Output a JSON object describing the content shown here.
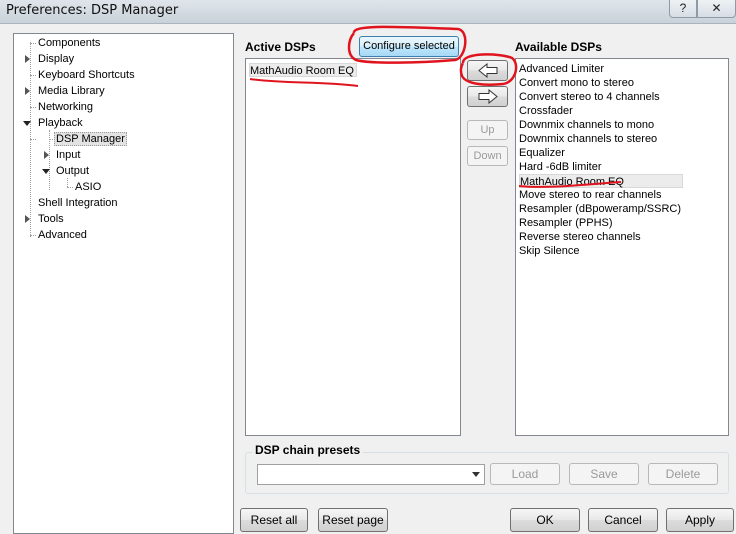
{
  "window": {
    "title": "Preferences: DSP Manager",
    "help_label": "?",
    "close_label": "✕"
  },
  "tree": {
    "items": [
      {
        "label": "Components"
      },
      {
        "label": "Display"
      },
      {
        "label": "Keyboard Shortcuts"
      },
      {
        "label": "Media Library"
      },
      {
        "label": "Networking"
      },
      {
        "label": "Playback"
      },
      {
        "label": "DSP Manager"
      },
      {
        "label": "Input"
      },
      {
        "label": "Output"
      },
      {
        "label": "ASIO"
      },
      {
        "label": "Shell Integration"
      },
      {
        "label": "Tools"
      },
      {
        "label": "Advanced"
      }
    ]
  },
  "dsp": {
    "active_title": "Active DSPs",
    "available_title": "Available DSPs",
    "configure_label": "Configure selected",
    "active": [
      "MathAudio Room EQ"
    ],
    "available": [
      "Advanced Limiter",
      "Convert mono to stereo",
      "Convert stereo to 4 channels",
      "Crossfader",
      "Downmix channels to mono",
      "Downmix channels to stereo",
      "Equalizer",
      "Hard -6dB limiter",
      "MathAudio Room EQ",
      "Move stereo to rear channels",
      "Resampler (dBpoweramp/SSRC)",
      "Resampler (PPHS)",
      "Reverse stereo channels",
      "Skip Silence"
    ],
    "add_icon": "left-arrow-icon",
    "remove_icon": "right-arrow-icon",
    "up_label": "Up",
    "down_label": "Down"
  },
  "presets": {
    "title": "DSP chain presets",
    "value": "",
    "load_label": "Load",
    "save_label": "Save",
    "delete_label": "Delete"
  },
  "footer": {
    "reset_all": "Reset all",
    "reset_page": "Reset page",
    "ok": "OK",
    "cancel": "Cancel",
    "apply": "Apply"
  },
  "colors": {
    "annotation": "#e0141e"
  }
}
